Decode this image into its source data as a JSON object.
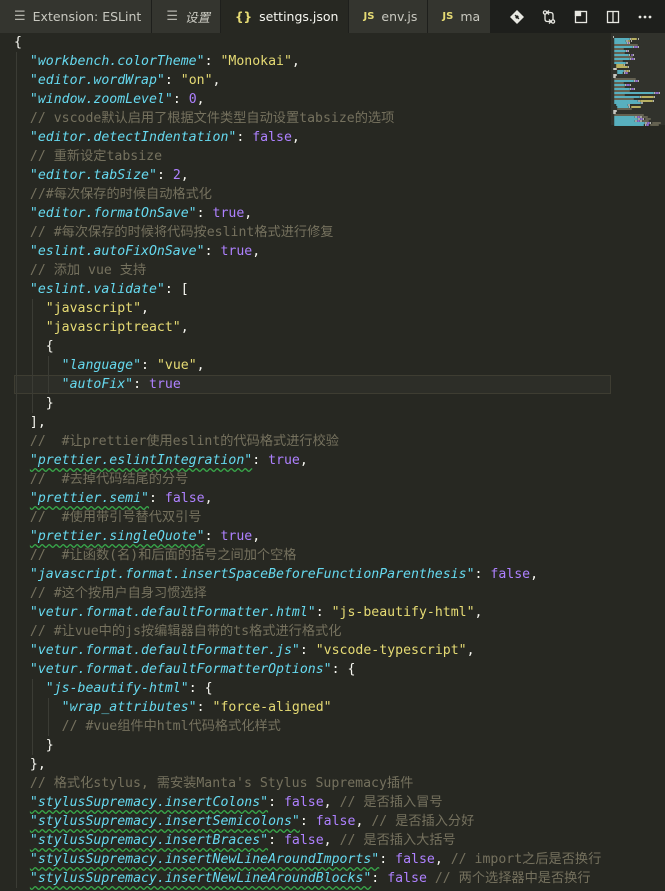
{
  "tabs": [
    {
      "label": "Extension: ESLint",
      "icon": "document-icon",
      "active": false,
      "italic": false
    },
    {
      "label": "设置",
      "icon": "document-icon",
      "active": false,
      "italic": true
    },
    {
      "label": "settings.json",
      "icon": "json-braces-icon",
      "active": true,
      "italic": false
    },
    {
      "label": "env.js",
      "icon": "js-icon",
      "active": false,
      "italic": false
    },
    {
      "label": "ma",
      "icon": "js-icon",
      "active": false,
      "italic": false
    }
  ],
  "tab_icon_glyphs": {
    "document": "☰",
    "json": "{}",
    "js": "JS"
  },
  "actions": [
    "source-control-diamond-icon",
    "compare-changes-icon",
    "open-preview-icon",
    "split-editor-icon",
    "more-actions-icon"
  ],
  "colors": {
    "background": "#272822",
    "keyword": "#66d9ef",
    "string": "#e6db74",
    "number": "#ae81ff",
    "comment": "#75715e",
    "text": "#f8f8f2"
  },
  "current_line": 19,
  "code_lines": [
    [
      [
        "p",
        "{"
      ]
    ],
    [
      [
        "p",
        "  "
      ],
      [
        "k",
        "\"workbench.colorTheme\""
      ],
      [
        "p",
        ": "
      ],
      [
        "s",
        "\"Monokai\""
      ],
      [
        "p",
        ","
      ]
    ],
    [
      [
        "p",
        "  "
      ],
      [
        "k",
        "\"editor.wordWrap\""
      ],
      [
        "p",
        ": "
      ],
      [
        "s",
        "\"on\""
      ],
      [
        "p",
        ","
      ]
    ],
    [
      [
        "p",
        "  "
      ],
      [
        "k",
        "\"window.zoomLevel\""
      ],
      [
        "p",
        ": "
      ],
      [
        "n",
        "0"
      ],
      [
        "p",
        ","
      ]
    ],
    [
      [
        "p",
        "  "
      ],
      [
        "c",
        "// vscode默认启用了根据文件类型自动设置tabsize的选项"
      ]
    ],
    [
      [
        "p",
        "  "
      ],
      [
        "k",
        "\"editor.detectIndentation\""
      ],
      [
        "p",
        ": "
      ],
      [
        "b",
        "false"
      ],
      [
        "p",
        ","
      ]
    ],
    [
      [
        "p",
        "  "
      ],
      [
        "c",
        "// 重新设定tabsize"
      ]
    ],
    [
      [
        "p",
        "  "
      ],
      [
        "k",
        "\"editor.tabSize\""
      ],
      [
        "p",
        ": "
      ],
      [
        "n",
        "2"
      ],
      [
        "p",
        ","
      ]
    ],
    [
      [
        "p",
        "  "
      ],
      [
        "c",
        "//#每次保存的时候自动格式化"
      ]
    ],
    [
      [
        "p",
        "  "
      ],
      [
        "k",
        "\"editor.formatOnSave\""
      ],
      [
        "p",
        ": "
      ],
      [
        "b",
        "true"
      ],
      [
        "p",
        ","
      ]
    ],
    [
      [
        "p",
        "  "
      ],
      [
        "c",
        "// #每次保存的时候将代码按eslint格式进行修复"
      ]
    ],
    [
      [
        "p",
        "  "
      ],
      [
        "k",
        "\"eslint.autoFixOnSave\""
      ],
      [
        "p",
        ": "
      ],
      [
        "b",
        "true"
      ],
      [
        "p",
        ","
      ]
    ],
    [
      [
        "p",
        "  "
      ],
      [
        "c",
        "// 添加 vue 支持"
      ]
    ],
    [
      [
        "p",
        "  "
      ],
      [
        "k",
        "\"eslint.validate\""
      ],
      [
        "p",
        ": ["
      ]
    ],
    [
      [
        "p",
        "    "
      ],
      [
        "s",
        "\"javascript\""
      ],
      [
        "p",
        ","
      ]
    ],
    [
      [
        "p",
        "    "
      ],
      [
        "s",
        "\"javascriptreact\""
      ],
      [
        "p",
        ","
      ]
    ],
    [
      [
        "p",
        "    {"
      ]
    ],
    [
      [
        "p",
        "      "
      ],
      [
        "k",
        "\"language\""
      ],
      [
        "p",
        ": "
      ],
      [
        "s",
        "\"vue\""
      ],
      [
        "p",
        ","
      ]
    ],
    [
      [
        "p",
        "      "
      ],
      [
        "k",
        "\"autoFix\""
      ],
      [
        "p",
        ": "
      ],
      [
        "b",
        "true"
      ]
    ],
    [
      [
        "p",
        "    }"
      ]
    ],
    [
      [
        "p",
        "  ],"
      ]
    ],
    [
      [
        "p",
        "  "
      ],
      [
        "c",
        "//  #让prettier使用eslint的代码格式进行校验"
      ]
    ],
    [
      [
        "p",
        "  "
      ],
      [
        "kw",
        "\"prettier.eslintIntegration\""
      ],
      [
        "p",
        ": "
      ],
      [
        "b",
        "true"
      ],
      [
        "p",
        ","
      ]
    ],
    [
      [
        "p",
        "  "
      ],
      [
        "c",
        "//  #去掉代码结尾的分号"
      ]
    ],
    [
      [
        "p",
        "  "
      ],
      [
        "kw",
        "\"prettier.semi\""
      ],
      [
        "p",
        ": "
      ],
      [
        "b",
        "false"
      ],
      [
        "p",
        ","
      ]
    ],
    [
      [
        "p",
        "  "
      ],
      [
        "c",
        "//  #使用带引号替代双引号"
      ]
    ],
    [
      [
        "p",
        "  "
      ],
      [
        "kw",
        "\"prettier.singleQuote\""
      ],
      [
        "p",
        ": "
      ],
      [
        "b",
        "true"
      ],
      [
        "p",
        ","
      ]
    ],
    [
      [
        "p",
        "  "
      ],
      [
        "c",
        "//  #让函数(名)和后面的括号之间加个空格"
      ]
    ],
    [
      [
        "p",
        "  "
      ],
      [
        "k",
        "\"javascript.format.insertSpaceBeforeFunctionParenthesis\""
      ],
      [
        "p",
        ": "
      ],
      [
        "b",
        "false"
      ],
      [
        "p",
        ","
      ]
    ],
    [
      [
        "p",
        "  "
      ],
      [
        "c",
        "// #这个按用户自身习惯选择"
      ]
    ],
    [
      [
        "p",
        "  "
      ],
      [
        "k",
        "\"vetur.format.defaultFormatter.html\""
      ],
      [
        "p",
        ": "
      ],
      [
        "s",
        "\"js-beautify-html\""
      ],
      [
        "p",
        ","
      ]
    ],
    [
      [
        "p",
        "  "
      ],
      [
        "c",
        "// #让vue中的js按编辑器自带的ts格式进行格式化"
      ]
    ],
    [
      [
        "p",
        "  "
      ],
      [
        "k",
        "\"vetur.format.defaultFormatter.js\""
      ],
      [
        "p",
        ": "
      ],
      [
        "s",
        "\"vscode-typescript\""
      ],
      [
        "p",
        ","
      ]
    ],
    [
      [
        "p",
        "  "
      ],
      [
        "k",
        "\"vetur.format.defaultFormatterOptions\""
      ],
      [
        "p",
        ": {"
      ]
    ],
    [
      [
        "p",
        "    "
      ],
      [
        "k",
        "\"js-beautify-html\""
      ],
      [
        "p",
        ": {"
      ]
    ],
    [
      [
        "p",
        "      "
      ],
      [
        "k",
        "\"wrap_attributes\""
      ],
      [
        "p",
        ": "
      ],
      [
        "s",
        "\"force-aligned\""
      ]
    ],
    [
      [
        "p",
        "      "
      ],
      [
        "c",
        "// #vue组件中html代码格式化样式"
      ]
    ],
    [
      [
        "p",
        "    }"
      ]
    ],
    [
      [
        "p",
        "  },"
      ]
    ],
    [
      [
        "p",
        "  "
      ],
      [
        "c",
        "// 格式化stylus, 需安装Manta's Stylus Supremacy插件"
      ]
    ],
    [
      [
        "p",
        "  "
      ],
      [
        "kw",
        "\"stylusSupremacy.insertColons\""
      ],
      [
        "p",
        ": "
      ],
      [
        "b",
        "false"
      ],
      [
        "p",
        ", "
      ],
      [
        "c",
        "// 是否插入冒号"
      ]
    ],
    [
      [
        "p",
        "  "
      ],
      [
        "kw",
        "\"stylusSupremacy.insertSemicolons\""
      ],
      [
        "p",
        ": "
      ],
      [
        "b",
        "false"
      ],
      [
        "p",
        ", "
      ],
      [
        "c",
        "// 是否插入分好"
      ]
    ],
    [
      [
        "p",
        "  "
      ],
      [
        "kw",
        "\"stylusSupremacy.insertBraces\""
      ],
      [
        "p",
        ": "
      ],
      [
        "b",
        "false"
      ],
      [
        "p",
        ", "
      ],
      [
        "c",
        "// 是否插入大括号"
      ]
    ],
    [
      [
        "p",
        "  "
      ],
      [
        "kw",
        "\"stylusSupremacy.insertNewLineAroundImports\""
      ],
      [
        "p",
        ": "
      ],
      [
        "b",
        "false"
      ],
      [
        "p",
        ", "
      ],
      [
        "c",
        "// import之后是否换行"
      ]
    ],
    [
      [
        "p",
        "  "
      ],
      [
        "kw",
        "\"stylusSupremacy.insertNewLineAroundBlocks\""
      ],
      [
        "p",
        ": "
      ],
      [
        "b",
        "false"
      ],
      [
        "p",
        " "
      ],
      [
        "c",
        "// 两个选择器中是否换行"
      ]
    ]
  ]
}
